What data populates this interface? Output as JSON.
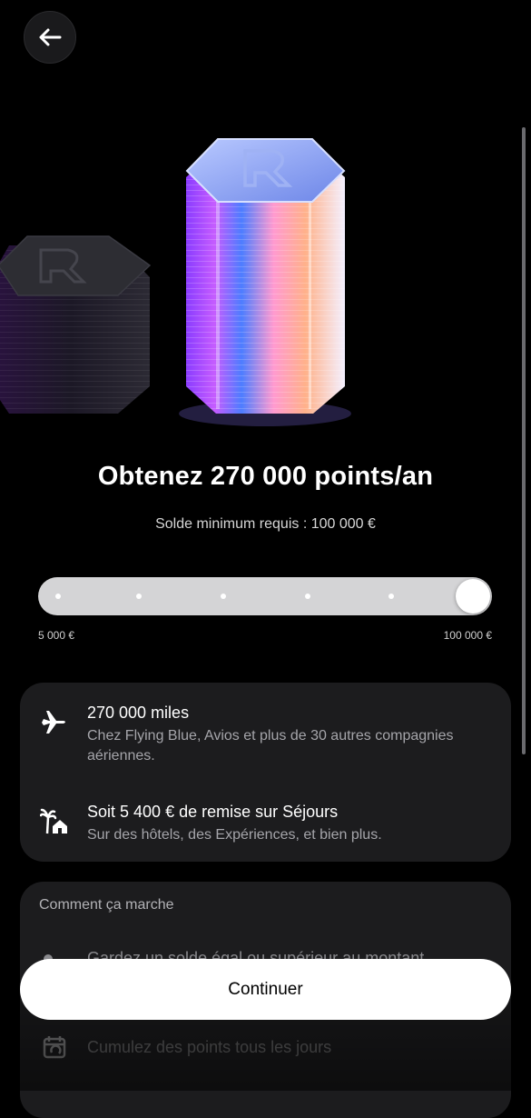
{
  "header": {
    "back_icon": "arrow-left-icon"
  },
  "hero": {
    "graphic": "coin-stacks-illustration",
    "logo_icon": "revolut-r-logo"
  },
  "offer": {
    "headline": "Obtenez 270 000 points/an",
    "min_balance": "Solde minimum requis : 100 000 €"
  },
  "slider": {
    "min_label": "5 000 €",
    "max_label": "100 000 €",
    "steps": 6,
    "selected_step": 6
  },
  "benefits": [
    {
      "icon": "airplane-icon",
      "title": "270 000 miles",
      "description": "Chez Flying Blue, Avios et plus de 30 autres compagnies aériennes."
    },
    {
      "icon": "vacation-home-icon",
      "title": "Soit 5 400 € de remise sur Séjours",
      "description": "Sur des hôtels, des Expériences, et bien plus."
    }
  ],
  "how_it_works": {
    "title": "Comment ça marche",
    "row1_text": "Gardez un solde égal ou supérieur au montant",
    "row2_icon": "calendar-refresh-icon",
    "row2_text": "Cumulez des points tous les jours"
  },
  "footer": {
    "continue_label": "Continuer"
  },
  "colors": {
    "background": "#000000",
    "card": "#1c1c1e",
    "track": "#d4d4d6",
    "button": "#ffffff"
  }
}
